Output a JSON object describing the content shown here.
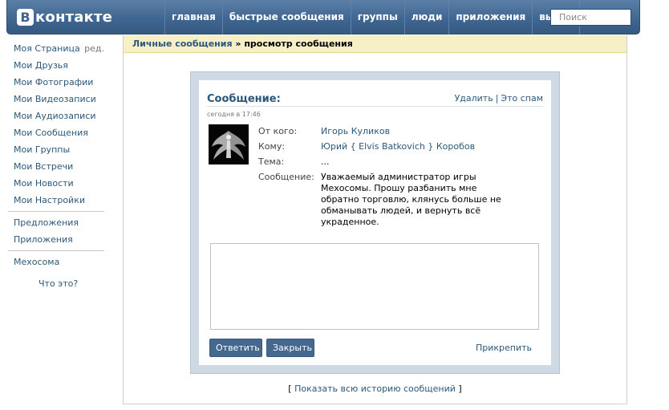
{
  "header": {
    "logo_letter": "В",
    "logo_text": "контакте",
    "nav": [
      "главная",
      "быстрые сообщения",
      "группы",
      "люди",
      "приложения",
      "выйти"
    ],
    "search_placeholder": "Поиск"
  },
  "sidebar": {
    "items": [
      "Моя Страница",
      "Мои Друзья",
      "Мои Фотографии",
      "Мои Видеозаписи",
      "Мои Аудиозаписи",
      "Мои Сообщения",
      "Мои Группы",
      "Мои Встречи",
      "Мои Новости",
      "Мои Настройки"
    ],
    "edit_label": "ред.",
    "extra": [
      "Предложения",
      "Приложения"
    ],
    "app": "Мехосома",
    "what": "Что это?"
  },
  "breadcrumb": {
    "link": "Личные сообщения",
    "sep": " » ",
    "current": "просмотр сообщения"
  },
  "message": {
    "title": "Сообщение:",
    "delete_label": "Удалить",
    "pipe": "|",
    "spam_label": "Это спам",
    "time": "сегодня в 17:46",
    "from_label": "От кого:",
    "from_value": "Игорь Куликов",
    "to_label": "Кому:",
    "to_value": "Юрий { Elvis Batkovich } Коробов",
    "subject_label": "Тема:",
    "subject_value": "...",
    "body_label": "Сообщение:",
    "body_value": "Уважаемый администратор игры Мехосомы. Прошу разбанить мне обратно торговлю, клянусь больше не обманывать людей, и вернуть всё украденное."
  },
  "actions": {
    "reply": "Ответить",
    "close": "Закрыть",
    "attach": "Прикрепить"
  },
  "history": {
    "open": "[ ",
    "link": "Показать всю историю сообщений",
    "close": " ]"
  },
  "colors": {
    "header": "#3e6591",
    "link": "#2b587a",
    "breadcrumb_bg": "#f7f0c6",
    "button": "#45688e"
  }
}
